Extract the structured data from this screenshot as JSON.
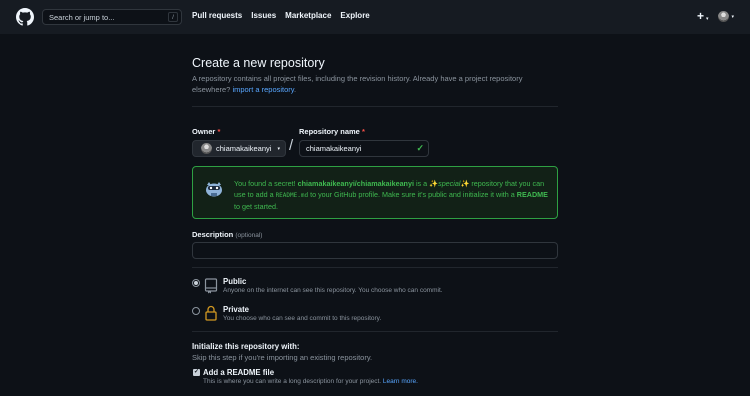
{
  "header": {
    "search_placeholder": "Search or jump to...",
    "search_shortcut": "/",
    "nav": [
      "Pull requests",
      "Issues",
      "Marketplace",
      "Explore"
    ],
    "plus": "+",
    "caret": "▾"
  },
  "page": {
    "title": "Create a new repository",
    "subtitle_prefix": "A repository contains all project files, including the revision history. Already have a project repository elsewhere? ",
    "subtitle_link": "import a repository",
    "subtitle_suffix": "."
  },
  "form": {
    "owner_label": "Owner",
    "required_mark": "*",
    "owner_value": "chiamakaikeanyi",
    "separator": "/",
    "repo_label": "Repository name",
    "repo_value": "chiamakaikeanyi",
    "valid_mark": "✓"
  },
  "secret": {
    "p1": "You found a secret! ",
    "bold_path": "chiamakaikeanyi/chiamakaikeanyi",
    "p2": " is a ✨",
    "special": "special",
    "p3": "✨ repository that you can use to add a ",
    "code": "README.md",
    "p4": " to your GitHub profile. Make sure it's public and initialize it with a ",
    "readme": "README",
    "p5": " to get started."
  },
  "description": {
    "label": "Description",
    "optional": "(optional)",
    "value": ""
  },
  "visibility": {
    "public_title": "Public",
    "public_desc": "Anyone on the internet can see this repository. You choose who can commit.",
    "private_title": "Private",
    "private_desc": "You choose who can see and commit to this repository.",
    "selected": "public"
  },
  "init": {
    "title": "Initialize this repository with:",
    "subtitle": "Skip this step if you're importing an existing repository.",
    "checkbox_mark": "✓",
    "readme_label": "Add a README file",
    "readme_desc": "This is where you can write a long description for your project. ",
    "learn_more": "Learn more.",
    "readme_checked": true
  },
  "colors": {
    "background": "#0d1117",
    "header": "#161b22",
    "link": "#58a6ff",
    "success": "#3fb950",
    "danger": "#f85149"
  }
}
